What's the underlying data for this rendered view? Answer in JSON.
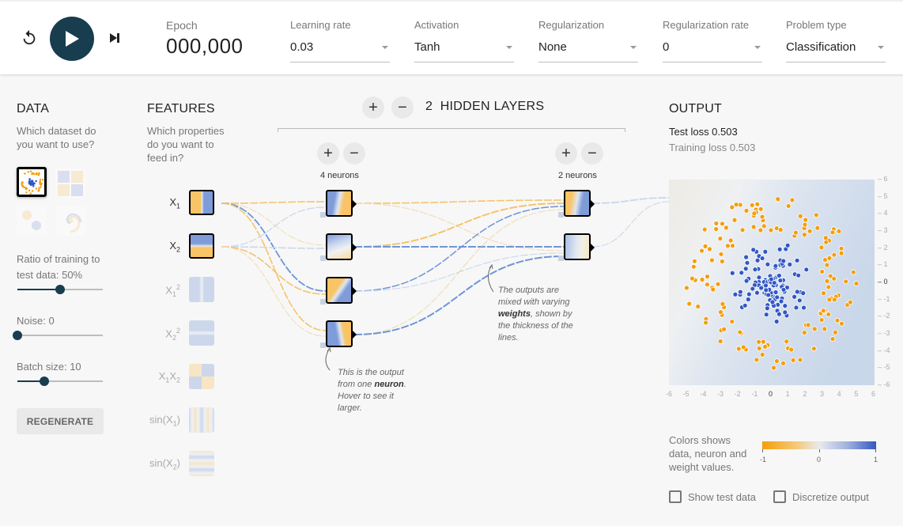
{
  "controls": {
    "reset_icon": "reset-icon",
    "play_icon": "play-icon",
    "step_icon": "step-forward-icon",
    "epoch_label": "Epoch",
    "epoch_value": "000,000"
  },
  "dropdowns": [
    {
      "label": "Learning rate",
      "value": "0.03"
    },
    {
      "label": "Activation",
      "value": "Tanh"
    },
    {
      "label": "Regularization",
      "value": "None"
    },
    {
      "label": "Regularization rate",
      "value": "0"
    },
    {
      "label": "Problem type",
      "value": "Classification"
    }
  ],
  "data_panel": {
    "title": "DATA",
    "subtitle": "Which dataset do you want to use?",
    "datasets": [
      {
        "name": "circle",
        "selected": true
      },
      {
        "name": "xor",
        "selected": false
      },
      {
        "name": "gaussian",
        "selected": false
      },
      {
        "name": "spiral",
        "selected": false
      }
    ],
    "ratio_label": "Ratio of training to test data:  50%",
    "ratio_value": 50,
    "noise_label": "Noise:  0",
    "noise_value": 0,
    "batch_label": "Batch size:  10",
    "batch_value": 10,
    "regenerate_label": "REGENERATE"
  },
  "features_panel": {
    "title": "FEATURES",
    "subtitle": "Which properties do you want to feed in?",
    "features": [
      {
        "id": "x1",
        "active": true
      },
      {
        "id": "x2",
        "active": true
      },
      {
        "id": "x1sq",
        "active": false
      },
      {
        "id": "x2sq",
        "active": false
      },
      {
        "id": "x1x2",
        "active": false
      },
      {
        "id": "sinx1",
        "active": false
      },
      {
        "id": "sinx2",
        "active": false
      }
    ]
  },
  "network": {
    "add_layer": "+",
    "remove_layer": "−",
    "layer_count": "2",
    "hidden_layers_label": "HIDDEN LAYERS",
    "layers": [
      {
        "neurons_label": "4 neurons",
        "add": "+",
        "remove": "−"
      },
      {
        "neurons_label": "2 neurons",
        "add": "+",
        "remove": "−"
      }
    ],
    "annotation_neuron_pre": "This is the output from one ",
    "annotation_neuron_bold": "neuron",
    "annotation_neuron_post": ". Hover to see it larger.",
    "annotation_weights_pre": "The outputs are mixed with varying ",
    "annotation_weights_bold": "weights",
    "annotation_weights_post": ", shown by the thickness of the lines."
  },
  "output": {
    "title": "OUTPUT",
    "test_loss": "Test loss 0.503",
    "training_loss": "Training loss 0.503",
    "x_ticks": [
      "-6",
      "-5",
      "-4",
      "-3",
      "-2",
      "-1",
      "0",
      "1",
      "2",
      "3",
      "4",
      "5",
      "6"
    ],
    "y_ticks": [
      "6",
      "5",
      "4",
      "3",
      "2",
      "1",
      "0",
      "-1",
      "-2",
      "-3",
      "-4",
      "-5",
      "-6"
    ],
    "legend_text": "Colors shows data, neuron and weight values.",
    "colorbar_ticks": [
      "-1",
      "0",
      "1"
    ],
    "show_test_data_label": "Show test data",
    "show_test_data": false,
    "discretize_label": "Discretize output",
    "discretize": false
  },
  "colors": {
    "primary": "#183d4e",
    "orange": "#f59e0b",
    "blue": "#3257c4"
  }
}
